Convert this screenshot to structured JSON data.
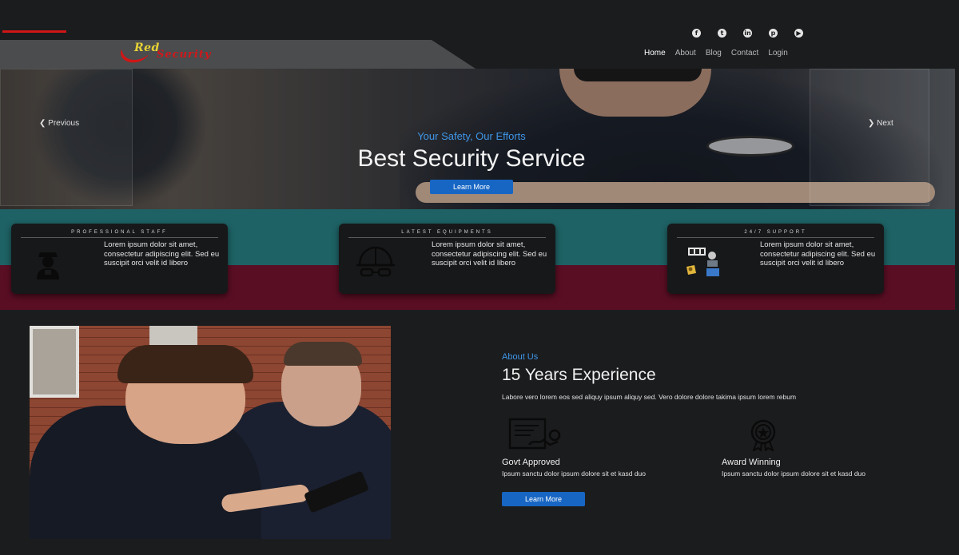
{
  "brand": {
    "word1": "Red",
    "word2": "Security",
    "colors": {
      "red": "#d01616",
      "yellow": "#e7d234"
    }
  },
  "social": [
    {
      "icon": "facebook-icon",
      "glyph": "f"
    },
    {
      "icon": "twitter-icon",
      "glyph": "t"
    },
    {
      "icon": "linkedin-icon",
      "glyph": "in"
    },
    {
      "icon": "pinterest-icon",
      "glyph": "p"
    },
    {
      "icon": "youtube-icon",
      "glyph": "▶"
    }
  ],
  "nav": {
    "items": [
      "Home",
      "About",
      "Blog",
      "Contact",
      "Login"
    ],
    "active": "Home"
  },
  "hero": {
    "subtitle": "Your Safety, Our Efforts",
    "title": "Best Security Service",
    "button": "Learn More",
    "prev": "❮ Previous",
    "next": "❯ Next"
  },
  "features": [
    {
      "title": "PROFESSIONAL STAFF",
      "icon": "security-guard-icon",
      "text": "Lorem ipsum dolor sit amet, consectetur adipiscing elit. Sed eu suscipit orci velit id libero"
    },
    {
      "title": "LATEST EQUIPMENTS",
      "icon": "helmet-icon",
      "text": "Lorem ipsum dolor sit amet, consectetur adipiscing elit. Sed eu suscipit orci velit id libero"
    },
    {
      "title": "24/7 SUPPORT",
      "icon": "support-24-7-icon",
      "text": "Lorem ipsum dolor sit amet, consectetur adipiscing elit. Sed eu suscipit orci velit id libero"
    }
  ],
  "about": {
    "label": "About Us",
    "title": "15 Years Experience",
    "description": "Labore vero lorem eos sed aliquy ipsum aliquy sed. Vero dolore dolore takima ipsum lorem rebum",
    "items": [
      {
        "icon": "certificate-icon",
        "title": "Govt Approved",
        "text": "Ipsum sanctu dolor ipsum dolore sit et kasd duo"
      },
      {
        "icon": "award-icon",
        "title": "Award Winning",
        "text": "Ipsum sanctu dolor ipsum dolore sit et kasd duo"
      }
    ],
    "button": "Learn More"
  },
  "theme": {
    "accent": "#1766c4",
    "teal": "#1e6265",
    "maroon": "#5a0e24",
    "background": "#1b1c1e"
  }
}
